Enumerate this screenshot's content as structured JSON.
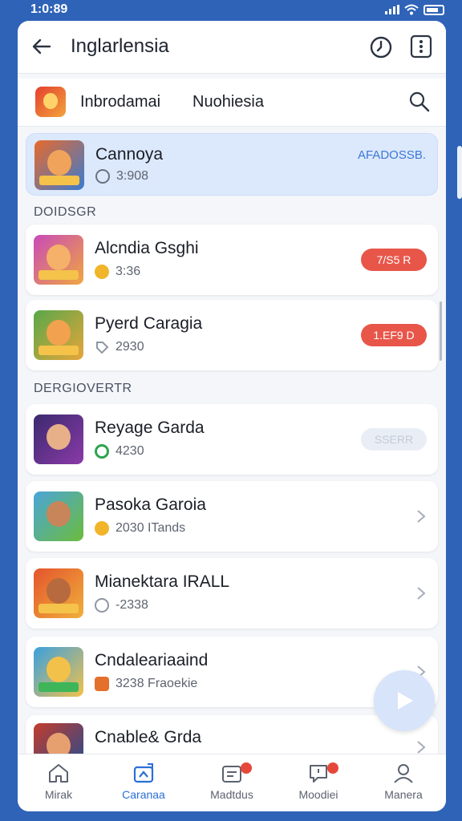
{
  "status_bar": {
    "time": "1:0:89"
  },
  "app_bar": {
    "title": "Inglarlensia"
  },
  "game_header": {
    "tab_left": "Inbrodamai",
    "tab_right": "Nuohiesia"
  },
  "selected": {
    "title": "Cannoya",
    "sub": "3:908",
    "action": "AFADOSSB."
  },
  "sections": {
    "first": "DOIDSGR",
    "second": "DERGIOVERTR"
  },
  "items": [
    {
      "title": "Alcndia Gsghi",
      "sub": "3:36",
      "action": "7/S5 R",
      "action_color": "#e8564a",
      "coin_color": "#f1b52a"
    },
    {
      "title": "Pyerd Caragia",
      "sub": "2930",
      "action": "1.EF9 D",
      "action_color": "#e8564a",
      "coin_color": "#8e96a3"
    },
    {
      "title": "Reyage Garda",
      "sub": "4230",
      "action": "SSERR",
      "action_color": "#e9eef6",
      "coin_color": "#2ea44f"
    },
    {
      "title": "Pasoka Garoia",
      "sub": "2030 ITands",
      "coin_color": "#f1b52a"
    },
    {
      "title": "Mianektara IRALL",
      "sub": "-2338",
      "coin_color": "#8e96a3"
    },
    {
      "title": "Cndaleariaaind",
      "sub": "3238 Fraoekie",
      "coin_color": "#e3702b"
    },
    {
      "title": "Cnable& Grda",
      "sub": "",
      "coin_color": "#f1b52a"
    }
  ],
  "bottom_nav": [
    {
      "label": "Mirak"
    },
    {
      "label": "Caranaa"
    },
    {
      "label": "Madtdus"
    },
    {
      "label": "Moodiei"
    },
    {
      "label": "Manera"
    }
  ],
  "colors": {
    "accent": "#2b6fd6",
    "danger": "#e8564a",
    "background": "#2f63b8"
  }
}
